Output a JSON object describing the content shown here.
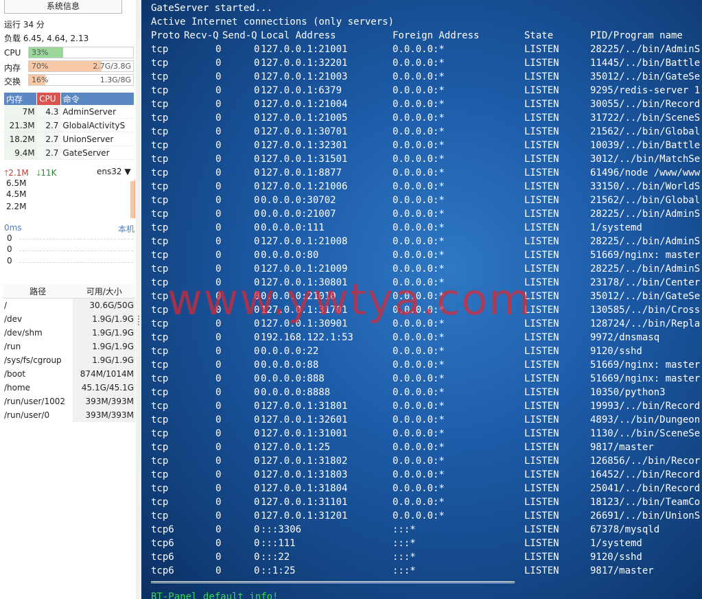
{
  "sidebar": {
    "title_button": "系统信息",
    "uptime": "运行 34 分",
    "load": "负载 6.45, 4.64, 2.13",
    "resources": [
      {
        "label": "CPU",
        "pct": "33%",
        "fraction": 0.33,
        "value": "",
        "color": "#9bd79b"
      },
      {
        "label": "内存",
        "pct": "70%",
        "fraction": 0.7,
        "value": "2.7G/3.8G",
        "color": "#f7c9a6"
      },
      {
        "label": "交换",
        "pct": "16%",
        "fraction": 0.16,
        "value": "1.3G/8G",
        "color": "#f7c9a6"
      }
    ],
    "process_table": {
      "headers": [
        "内存",
        "CPU",
        "命令"
      ],
      "rows": [
        [
          "7M",
          "4.3",
          "AdminServer"
        ],
        [
          "21.3M",
          "2.7",
          "GlobalActivityS"
        ],
        [
          "18.2M",
          "2.7",
          "UnionServer"
        ],
        [
          "9.4M",
          "2.7",
          "GateServer"
        ]
      ]
    },
    "network": {
      "up": "2.1M",
      "down": "11K",
      "interface": "ens32",
      "ticks": [
        "6.5M",
        "4.5M",
        "2.2M"
      ]
    },
    "latency": {
      "label": "0ms",
      "target": "本机",
      "ticks": [
        "0",
        "0",
        "0"
      ]
    },
    "disk_table": {
      "headers": [
        "路径",
        "可用/大小"
      ],
      "rows": [
        [
          "/",
          "30.6G/50G"
        ],
        [
          "/dev",
          "1.9G/1.9G"
        ],
        [
          "/dev/shm",
          "1.9G/1.9G"
        ],
        [
          "/run",
          "1.9G/1.9G"
        ],
        [
          "/sys/fs/cgroup",
          "1.9G/1.9G"
        ],
        [
          "/boot",
          "874M/1014M"
        ],
        [
          "/home",
          "45.1G/45.1G"
        ],
        [
          "/run/user/1002",
          "393M/393M"
        ],
        [
          "/run/user/0",
          "393M/393M"
        ]
      ]
    }
  },
  "terminal": {
    "line1": "GateServer started...",
    "line2": "Active Internet connections (only servers)",
    "headers": [
      "Proto",
      "Recv-Q",
      "Send-Q",
      "Local Address",
      "Foreign Address",
      "State",
      "PID/Program name"
    ],
    "rows": [
      [
        "tcp",
        "0",
        "0",
        "127.0.0.1:21001",
        "0.0.0.0:*",
        "LISTEN",
        "28225/../bin/AdminS"
      ],
      [
        "tcp",
        "0",
        "0",
        "127.0.0.1:32201",
        "0.0.0.0:*",
        "LISTEN",
        "11445/../bin/Battle"
      ],
      [
        "tcp",
        "0",
        "0",
        "127.0.0.1:21003",
        "0.0.0.0:*",
        "LISTEN",
        "35012/../bin/GateSe"
      ],
      [
        "tcp",
        "0",
        "0",
        "127.0.0.1:6379",
        "0.0.0.0:*",
        "LISTEN",
        "9295/redis-server 1"
      ],
      [
        "tcp",
        "0",
        "0",
        "127.0.0.1:21004",
        "0.0.0.0:*",
        "LISTEN",
        "30055/../bin/Record"
      ],
      [
        "tcp",
        "0",
        "0",
        "127.0.0.1:21005",
        "0.0.0.0:*",
        "LISTEN",
        "31722/../bin/SceneS"
      ],
      [
        "tcp",
        "0",
        "0",
        "127.0.0.1:30701",
        "0.0.0.0:*",
        "LISTEN",
        "21562/../bin/Global"
      ],
      [
        "tcp",
        "0",
        "0",
        "127.0.0.1:32301",
        "0.0.0.0:*",
        "LISTEN",
        "10039/../bin/Battle"
      ],
      [
        "tcp",
        "0",
        "0",
        "127.0.0.1:31501",
        "0.0.0.0:*",
        "LISTEN",
        "3012/../bin/MatchSe"
      ],
      [
        "tcp",
        "0",
        "0",
        "127.0.0.1:8877",
        "0.0.0.0:*",
        "LISTEN",
        "61496/node /www/www"
      ],
      [
        "tcp",
        "0",
        "0",
        "127.0.0.1:21006",
        "0.0.0.0:*",
        "LISTEN",
        "33150/../bin/WorldS"
      ],
      [
        "tcp",
        "0",
        "0",
        "0.0.0.0:30702",
        "0.0.0.0:*",
        "LISTEN",
        "21562/../bin/Global"
      ],
      [
        "tcp",
        "0",
        "0",
        "0.0.0.0:21007",
        "0.0.0.0:*",
        "LISTEN",
        "28225/../bin/AdminS"
      ],
      [
        "tcp",
        "0",
        "0",
        "0.0.0.0:111",
        "0.0.0.0:*",
        "LISTEN",
        "1/systemd"
      ],
      [
        "tcp",
        "0",
        "0",
        "127.0.0.1:21008",
        "0.0.0.0:*",
        "LISTEN",
        "28225/../bin/AdminS"
      ],
      [
        "tcp",
        "0",
        "0",
        "0.0.0.0:80",
        "0.0.0.0:*",
        "LISTEN",
        "51669/nginx: master"
      ],
      [
        "tcp",
        "0",
        "0",
        "127.0.0.1:21009",
        "0.0.0.0:*",
        "LISTEN",
        "28225/../bin/AdminS"
      ],
      [
        "tcp",
        "0",
        "0",
        "127.0.0.1:30801",
        "0.0.0.0:*",
        "LISTEN",
        "23178/../bin/Center"
      ],
      [
        "tcp",
        "0",
        "0",
        "0.0.0.0:21010",
        "0.0.0.0:*",
        "LISTEN",
        "35012/../bin/GateSe"
      ],
      [
        "tcp",
        "0",
        "0",
        "127.0.0.1:31701",
        "0.0.0.0:*",
        "LISTEN",
        "130585/../bin/Cross"
      ],
      [
        "tcp",
        "0",
        "0",
        "127.0.0.1:30901",
        "0.0.0.0:*",
        "LISTEN",
        "128724/../bin/Repla"
      ],
      [
        "tcp",
        "0",
        "0",
        "192.168.122.1:53",
        "0.0.0.0:*",
        "LISTEN",
        "9972/dnsmasq"
      ],
      [
        "tcp",
        "0",
        "0",
        "0.0.0.0:22",
        "0.0.0.0:*",
        "LISTEN",
        "9120/sshd"
      ],
      [
        "tcp",
        "0",
        "0",
        "0.0.0.0:88",
        "0.0.0.0:*",
        "LISTEN",
        "51669/nginx: master"
      ],
      [
        "tcp",
        "0",
        "0",
        "0.0.0.0:888",
        "0.0.0.0:*",
        "LISTEN",
        "51669/nginx: master"
      ],
      [
        "tcp",
        "0",
        "0",
        "0.0.0.0:8888",
        "0.0.0.0:*",
        "LISTEN",
        "10350/python3"
      ],
      [
        "tcp",
        "0",
        "0",
        "127.0.0.1:31801",
        "0.0.0.0:*",
        "LISTEN",
        "19993/../bin/Record"
      ],
      [
        "tcp",
        "0",
        "0",
        "127.0.0.1:32601",
        "0.0.0.0:*",
        "LISTEN",
        "4893/../bin/Dungeon"
      ],
      [
        "tcp",
        "0",
        "0",
        "127.0.0.1:31001",
        "0.0.0.0:*",
        "LISTEN",
        "1130/../bin/SceneSe"
      ],
      [
        "tcp",
        "0",
        "0",
        "127.0.0.1:25",
        "0.0.0.0:*",
        "LISTEN",
        "9817/master"
      ],
      [
        "tcp",
        "0",
        "0",
        "127.0.0.1:31802",
        "0.0.0.0:*",
        "LISTEN",
        "126856/../bin/Recor"
      ],
      [
        "tcp",
        "0",
        "0",
        "127.0.0.1:31803",
        "0.0.0.0:*",
        "LISTEN",
        "16452/../bin/Record"
      ],
      [
        "tcp",
        "0",
        "0",
        "127.0.0.1:31804",
        "0.0.0.0:*",
        "LISTEN",
        "25041/../bin/Record"
      ],
      [
        "tcp",
        "0",
        "0",
        "127.0.0.1:31101",
        "0.0.0.0:*",
        "LISTEN",
        "18123/../bin/TeamCo"
      ],
      [
        "tcp",
        "0",
        "0",
        "127.0.0.1:31201",
        "0.0.0.0:*",
        "LISTEN",
        "26691/../bin/UnionS"
      ],
      [
        "tcp6",
        "0",
        "0",
        ":::3306",
        ":::*",
        "LISTEN",
        "67378/mysqld"
      ],
      [
        "tcp6",
        "0",
        "0",
        ":::111",
        ":::*",
        "LISTEN",
        "1/systemd"
      ],
      [
        "tcp6",
        "0",
        "0",
        ":::22",
        ":::*",
        "LISTEN",
        "9120/sshd"
      ],
      [
        "tcp6",
        "0",
        "0",
        "::1:25",
        ":::*",
        "LISTEN",
        "9817/master"
      ]
    ],
    "separator": "==================================================",
    "footer": "BT-Panel default info!",
    "watermark": "www.ywtya.com"
  }
}
